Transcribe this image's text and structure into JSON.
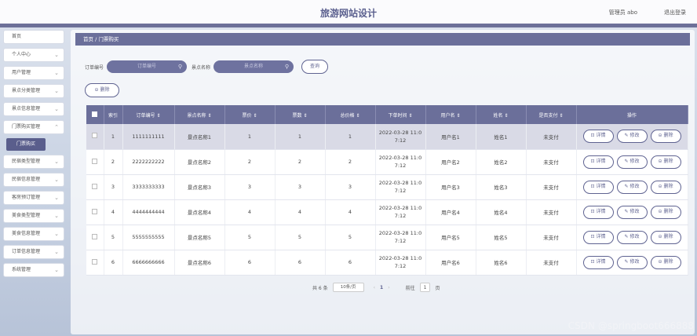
{
  "header": {
    "title": "旅游网站设计",
    "user": "管理员 abo",
    "logout": "退出登录"
  },
  "sidebar": {
    "items": [
      {
        "label": "首页",
        "chev": ""
      },
      {
        "label": "个人中心",
        "chev": "⌄"
      },
      {
        "label": "用户管理",
        "chev": "⌄"
      },
      {
        "label": "景点分类管理",
        "chev": "⌄"
      },
      {
        "label": "景点信息管理",
        "chev": "⌄"
      },
      {
        "label": "门票购买管理",
        "chev": "⌃"
      },
      {
        "label": "民宿类型管理",
        "chev": "⌄"
      },
      {
        "label": "民宿信息管理",
        "chev": "⌄"
      },
      {
        "label": "客房预订管理",
        "chev": "⌄"
      },
      {
        "label": "美食类型管理",
        "chev": "⌄"
      },
      {
        "label": "美食信息管理",
        "chev": "⌄"
      },
      {
        "label": "订单信息管理",
        "chev": "⌄"
      },
      {
        "label": "系统管理",
        "chev": "⌄"
      }
    ],
    "active_sub": "门票购买"
  },
  "breadcrumb": {
    "home": "首页",
    "sep": " / ",
    "current": "门票购买"
  },
  "filters": {
    "order_label": "订单编号",
    "order_placeholder": "订单编号",
    "scenic_label": "景点名称",
    "scenic_placeholder": "景点名称",
    "search_btn": "查询"
  },
  "toolbar": {
    "delete_btn": "⊝ 删除"
  },
  "table": {
    "headers": [
      "",
      "索引",
      "订单编号 ⇕",
      "景点名称 ⇕",
      "票价 ⇕",
      "票数 ⇕",
      "总价格 ⇕",
      "下单时间 ⇕",
      "用户名 ⇕",
      "姓名 ⇕",
      "是否支付 ⇕",
      "操作"
    ],
    "rows": [
      {
        "idx": "1",
        "order": "1111111111",
        "scenic": "景点名称1",
        "price": "1",
        "qty": "1",
        "total": "1",
        "time": "2022-03-28 11:0\n7:12",
        "user": "用户名1",
        "name": "姓名1",
        "paid": "未支付"
      },
      {
        "idx": "2",
        "order": "2222222222",
        "scenic": "景点名称2",
        "price": "2",
        "qty": "2",
        "total": "2",
        "time": "2022-03-28 11:0\n7:12",
        "user": "用户名2",
        "name": "姓名2",
        "paid": "未支付"
      },
      {
        "idx": "3",
        "order": "3333333333",
        "scenic": "景点名称3",
        "price": "3",
        "qty": "3",
        "total": "3",
        "time": "2022-03-28 11:0\n7:12",
        "user": "用户名3",
        "name": "姓名3",
        "paid": "未支付"
      },
      {
        "idx": "4",
        "order": "4444444444",
        "scenic": "景点名称4",
        "price": "4",
        "qty": "4",
        "total": "4",
        "time": "2022-03-28 11:0\n7:12",
        "user": "用户名4",
        "name": "姓名4",
        "paid": "未支付"
      },
      {
        "idx": "5",
        "order": "5555555555",
        "scenic": "景点名称5",
        "price": "5",
        "qty": "5",
        "total": "5",
        "time": "2022-03-28 11:0\n7:12",
        "user": "用户名5",
        "name": "姓名5",
        "paid": "未支付"
      },
      {
        "idx": "6",
        "order": "6666666666",
        "scenic": "景点名称6",
        "price": "6",
        "qty": "6",
        "total": "6",
        "time": "2022-03-28 11:0\n7:12",
        "user": "用户名6",
        "name": "姓名6",
        "paid": "未支付"
      }
    ],
    "actions": {
      "detail": "⊡ 详情",
      "edit": "✎ 修改",
      "delete": "⊝ 删除"
    }
  },
  "pagination": {
    "total": "共 6 条",
    "page_size": "10条/页",
    "prev": "‹",
    "page": "1",
    "next": "›",
    "goto": "前往",
    "goto_page": "1",
    "page_unit": "页"
  },
  "watermark": "CSDN @springboot666888",
  "colors": {
    "primary": "#6b6f9a",
    "accent": "#5f6391"
  }
}
